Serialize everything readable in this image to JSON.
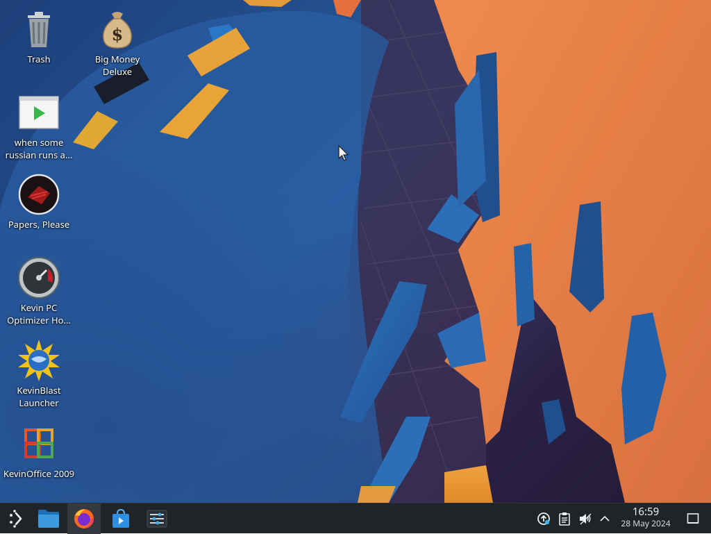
{
  "desktop": {
    "icons": [
      {
        "label": "Trash",
        "icon": "trash-icon"
      },
      {
        "label": "Big Money Deluxe",
        "icon": "money-bag-icon"
      },
      {
        "label": "when some russian runs a...",
        "icon": "video-play-icon"
      },
      {
        "label": "Papers, Please",
        "icon": "papers-please-icon"
      },
      {
        "label": "Kevin PC Optimizer Ho...",
        "icon": "speedometer-icon"
      },
      {
        "label": "KevinBlast Launcher",
        "icon": "kevinblast-icon"
      },
      {
        "label": "KevinOffice 2009",
        "icon": "office-icon"
      }
    ]
  },
  "taskbar": {
    "apps": [
      "app-launcher-icon",
      "file-manager-icon",
      "firefox-icon",
      "discover-store-icon",
      "system-settings-icon"
    ],
    "tray": [
      "updates-icon",
      "clipboard-icon",
      "volume-muted-icon",
      "show-hidden-icons-icon"
    ],
    "clock": {
      "time": "16:59",
      "date": "28 May 2024"
    },
    "show_desktop_icon": "show-desktop-icon"
  },
  "colors": {
    "taskbar": "#1f2428",
    "orange": "#e8824a",
    "blue": "#2d6fb5"
  }
}
